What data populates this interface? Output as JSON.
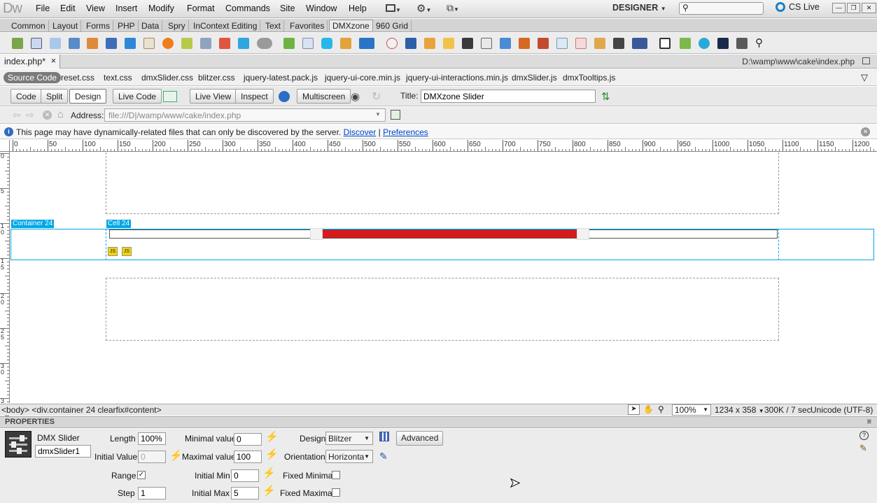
{
  "app": {
    "logo": "Dw"
  },
  "menu": [
    "File",
    "Edit",
    "View",
    "Insert",
    "Modify",
    "Format",
    "Commands",
    "Site",
    "Window",
    "Help"
  ],
  "workspace": "DESIGNER",
  "cs_live": "CS Live",
  "insert_tabs": [
    "Common",
    "Layout",
    "Forms",
    "PHP",
    "Data",
    "Spry",
    "InContext Editing",
    "Text",
    "Favorites",
    "DMXzone",
    "960 Grid"
  ],
  "active_insert_tab": "DMXzone",
  "doc_tab": {
    "name": "index.php*",
    "close": "×"
  },
  "doc_path": "D:\\wamp\\www\\cake\\index.php",
  "related_files": [
    "reset.css",
    "text.css",
    "dmxSlider.css",
    "blitzer.css",
    "jquery-latest.pack.js",
    "jquery-ui-core.min.js",
    "jquery-ui-interactions.min.js",
    "dmxSlider.js",
    "dmxTooltips.js"
  ],
  "source_code_label": "Source Code",
  "doc_toolbar": {
    "code": "Code",
    "split": "Split",
    "design": "Design",
    "live_code": "Live Code",
    "live_view": "Live View",
    "inspect": "Inspect",
    "multiscreen": "Multiscreen",
    "title_label": "Title:",
    "title_value": "DMXzone Slider"
  },
  "address": {
    "label": "Address:",
    "value": "file:///D|/wamp/www/cake/index.php"
  },
  "info": {
    "text": "This page may have dynamically-related files that can only be discovered by the server.",
    "discover": "Discover",
    "sep": "|",
    "preferences": "Preferences"
  },
  "ruler_h": [
    "0",
    "50",
    "100",
    "150",
    "200",
    "250",
    "300",
    "350",
    "400",
    "450",
    "500",
    "550",
    "600",
    "650",
    "700",
    "750",
    "800",
    "850",
    "900",
    "950",
    "1000",
    "1050",
    "1100",
    "1150",
    "1200"
  ],
  "ruler_v": [
    "0",
    "5",
    "1 0",
    "1 5",
    "2 0",
    "2 5",
    "3 0",
    "3"
  ],
  "canvas": {
    "container_tag": "Container 24",
    "cell_tag": "Cell 24",
    "slider_range": [
      0.3,
      0.7
    ],
    "slider_color": "#d7191c"
  },
  "status": {
    "tag_path": "<body> <div.container  24 clearfix#content>",
    "zoom": "100%",
    "size": "1234 x 358",
    "download": "300K / 7 sec",
    "encoding": "Unicode (UTF-8)"
  },
  "properties": {
    "header": "PROPERTIES",
    "component": "DMX Slider",
    "id": "dmxSlider1",
    "length_label": "Length",
    "length_value": "100%",
    "initial_value_label": "Initial Value",
    "initial_value": "0",
    "min_label": "Minimal value",
    "min_value": "0",
    "max_label": "Maximal value",
    "max_value": "100",
    "design_label": "Design",
    "design_value": "Blitzer",
    "advanced": "Advanced",
    "orientation_label": "Orientation",
    "orientation_value": "Horizonta",
    "range_label": "Range",
    "range_checked": true,
    "step_label": "Step",
    "step_value": "1",
    "initial_min_label": "Initial Min",
    "initial_min_value": "0",
    "initial_max_label": "Initial Max",
    "initial_max_value": "5",
    "fixed_min_label": "Fixed Minimal",
    "fixed_max_label": "Fixed Maximal"
  }
}
